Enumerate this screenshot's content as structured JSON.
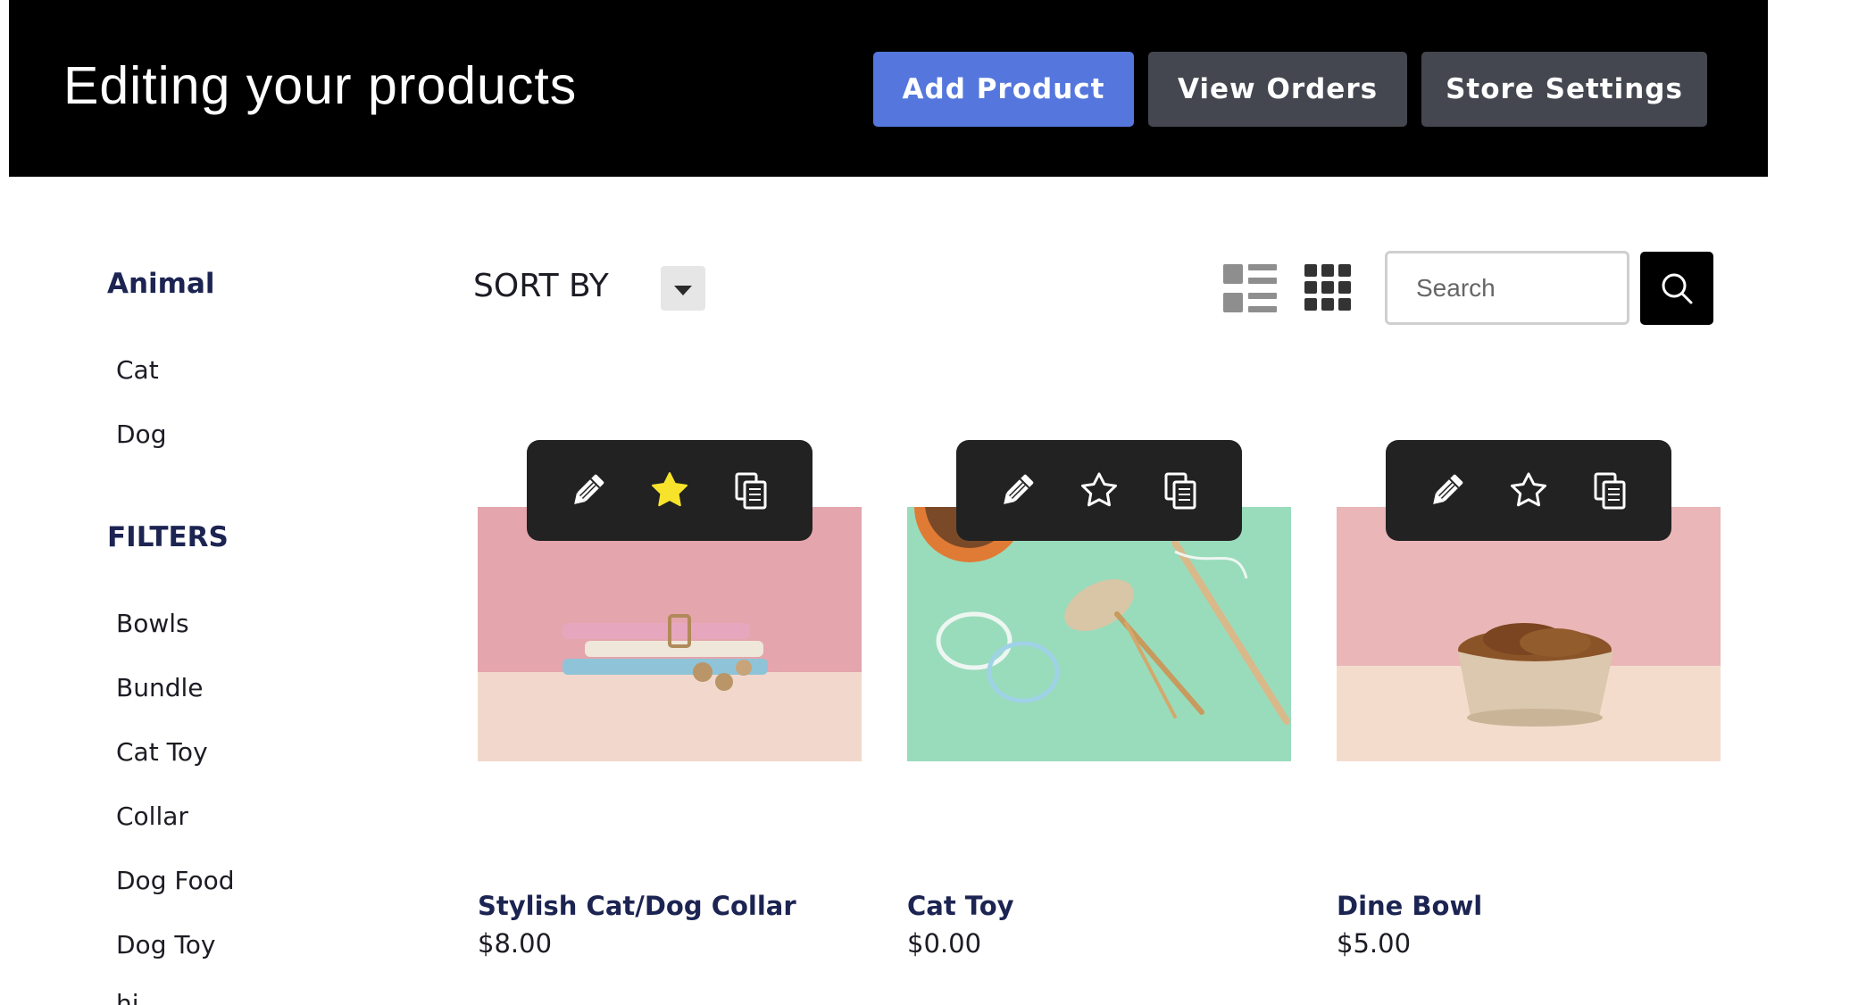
{
  "header": {
    "title": "Editing your products",
    "buttons": {
      "add_product": "Add Product",
      "view_orders": "View Orders",
      "store_settings": "Store Settings"
    }
  },
  "sidebar": {
    "animal_heading": "Animal",
    "animals": [
      "Cat",
      "Dog"
    ],
    "filters_heading": "FILTERS",
    "filters": [
      "Bowls",
      "Bundle",
      "Cat Toy",
      "Collar",
      "Dog Food",
      "Dog Toy",
      "hi"
    ]
  },
  "toolbar": {
    "sort_label": "SORT BY",
    "search_placeholder": "Search"
  },
  "products": [
    {
      "name": "Stylish Cat/Dog Collar",
      "price": "$8.00",
      "featured": true
    },
    {
      "name": "Cat Toy",
      "price": "$0.00",
      "featured": false
    },
    {
      "name": "Dine Bowl",
      "price": "$5.00",
      "featured": false
    }
  ],
  "colors": {
    "accent": "#5577dd",
    "header_bg": "#000000",
    "secondary_button": "#44474f",
    "heading_navy": "#1c2452",
    "star_featured": "#f7e32b",
    "action_bar": "#222222"
  },
  "icons": {
    "edit": "pencil-icon",
    "feature": "star-icon",
    "duplicate": "copy-icon",
    "search": "search-icon",
    "list_view": "list-view-icon",
    "grid_view": "grid-view-icon"
  }
}
